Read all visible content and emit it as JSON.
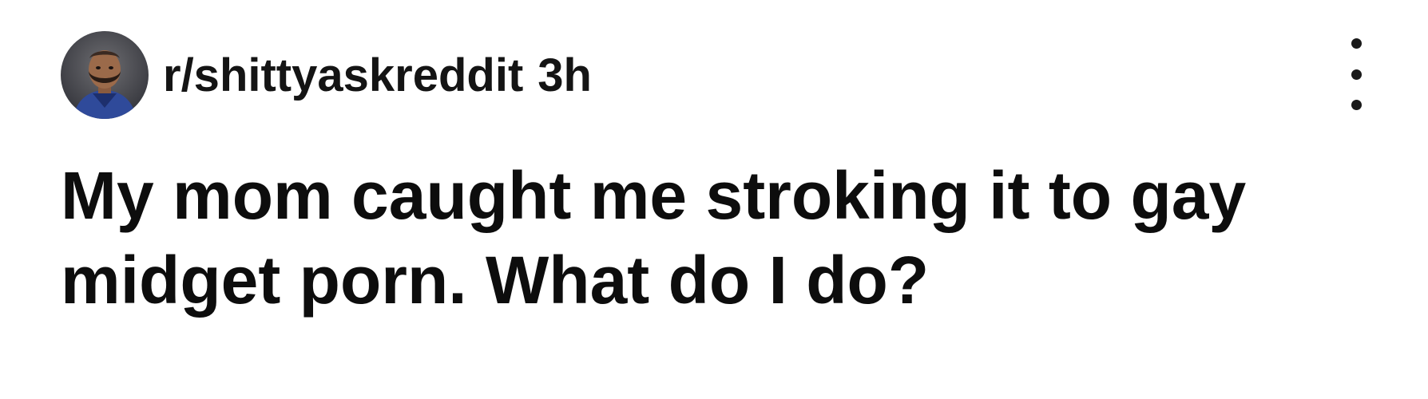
{
  "post": {
    "subreddit": "r/shittyaskreddit",
    "time": "3h",
    "title": "My mom caught me stroking it to gay midget porn. What do I do?"
  },
  "icons": {
    "avatar": "profile-photo",
    "menu": "more-vertical-icon"
  },
  "colors": {
    "background": "#ffffff",
    "text": "#111111"
  }
}
